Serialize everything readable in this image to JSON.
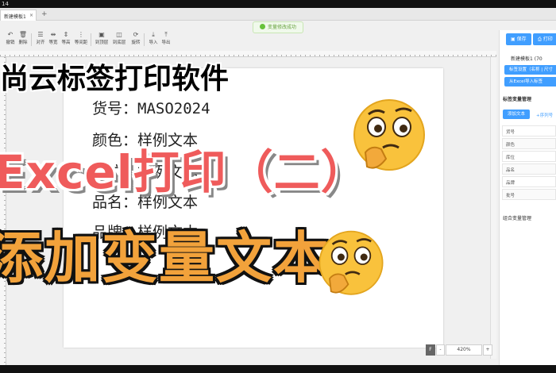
{
  "window": {
    "title": "14",
    "tab_label": "新建模板1",
    "tab_close": "×",
    "tab_add": "+"
  },
  "toast": {
    "text": "变量修改成功"
  },
  "toolbar": {
    "items": [
      {
        "icon": "undo-icon",
        "glyph": "↶",
        "label": "撤销"
      },
      {
        "icon": "trash-icon",
        "glyph": "🗑",
        "label": "删除"
      },
      {
        "icon": "align-icon",
        "glyph": "☰",
        "label": "对齐"
      },
      {
        "icon": "equal-width-icon",
        "glyph": "⇹",
        "label": "等宽"
      },
      {
        "icon": "equal-height-icon",
        "glyph": "⇕",
        "label": "等高"
      },
      {
        "icon": "equal-spacing-icon",
        "glyph": "⋮",
        "label": "等间距"
      },
      {
        "icon": "bring-front-icon",
        "glyph": "▣",
        "label": "到顶层"
      },
      {
        "icon": "send-back-icon",
        "glyph": "◫",
        "label": "到底层"
      },
      {
        "icon": "rotate-icon",
        "glyph": "⟳",
        "label": "旋转"
      },
      {
        "icon": "import-icon",
        "glyph": "⤓",
        "label": "导入"
      },
      {
        "icon": "export-icon",
        "glyph": "⤒",
        "label": "导出"
      }
    ]
  },
  "canvas": {
    "fields": [
      {
        "label": "货号：",
        "value": "MASO2024"
      },
      {
        "label": "颜色：",
        "value": "样例文本"
      },
      {
        "label": "库位：",
        "value": "样例文本"
      },
      {
        "label": "品名：",
        "value": "样例文本"
      },
      {
        "label": "品牌：",
        "value": "样例文本"
      }
    ]
  },
  "panel": {
    "save_label": "保存",
    "print_label": "打印",
    "template_name": "新建模板1 (70",
    "label_settings": "标签设置（名称 | 尺寸",
    "import_excel": "从Excel导入标签",
    "section_vars": "标签变量管理",
    "add_text": "添加文本",
    "add_serial": "+序列号",
    "variables": [
      "货号",
      "颜色",
      "库位",
      "品名",
      "品牌",
      "批号"
    ],
    "section_combo": "组合变量管理"
  },
  "statusbar": {
    "zoom": "420%",
    "minus": "-",
    "plus": "+",
    "fill": "F"
  },
  "overlay": {
    "title_line": "尚云标签打印软件",
    "subtitle_line": "Excel打印（二）",
    "bottom_line": "添加变量文本"
  },
  "colors": {
    "accent": "#409eff",
    "overlay_red": "#ef5b5b",
    "overlay_orange": "#f2a23b",
    "toast_green": "#67c23a"
  }
}
